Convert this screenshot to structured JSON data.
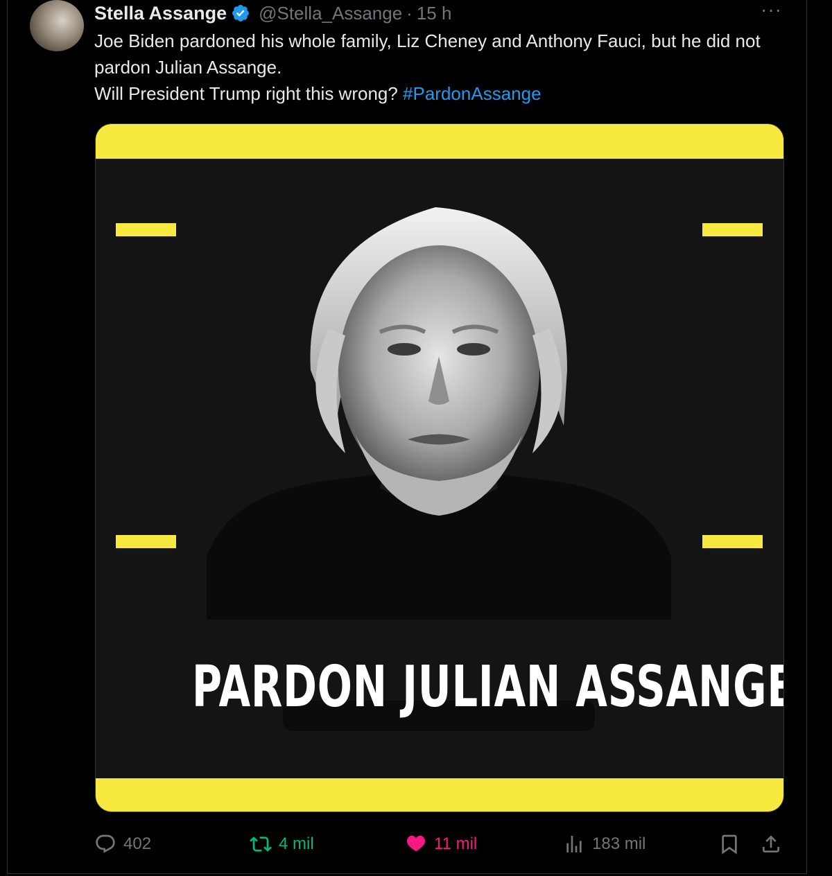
{
  "author": {
    "name": "Stella Assange",
    "handle": "@Stella_Assange",
    "separator": "·",
    "time": "15 h",
    "verified": true
  },
  "more_label": "···",
  "text": {
    "line1": "Joe Biden pardoned his whole family, Liz Cheney and Anthony Fauci, but he did not pardon Julian Assange.",
    "line2_prefix": "Will President Trump right this wrong? ",
    "hashtag": "#PardonAssange"
  },
  "media": {
    "poster_title": "PARDON JULIAN ASSANGE",
    "accent_color": "#f7e93f"
  },
  "actions": {
    "replies": "402",
    "retweets": "4 mil",
    "likes": "11 mil",
    "views": "183 mil"
  },
  "colors": {
    "retweet": "#00ba7c",
    "like": "#f91880",
    "link": "#1d9bf0",
    "verified": "#1d9bf0"
  }
}
